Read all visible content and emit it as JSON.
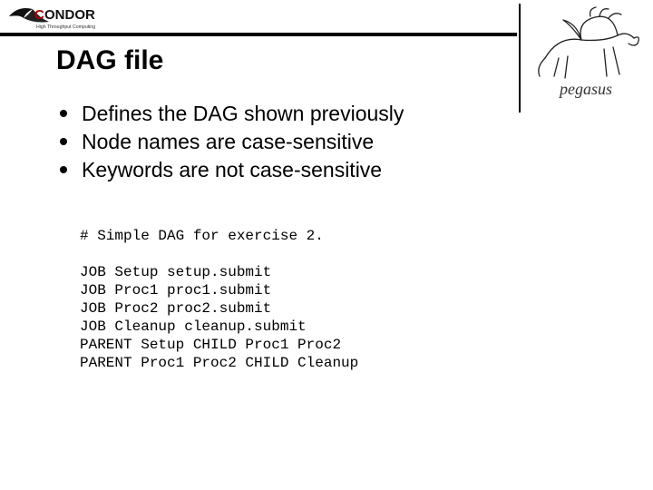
{
  "header": {
    "title": "DAG file",
    "logo_left_name": "CONDOR",
    "logo_left_tagline": "High Throughput Computing",
    "logo_right_label": "pegasus"
  },
  "bullets": [
    "Defines the DAG shown previously",
    "Node names are case-sensitive",
    "Keywords are not case-sensitive"
  ],
  "code": {
    "comment": "# Simple DAG for exercise 2.",
    "lines": [
      "JOB Setup setup.submit",
      "JOB Proc1 proc1.submit",
      "JOB Proc2 proc2.submit",
      "JOB Cleanup cleanup.submit",
      "PARENT Setup CHILD Proc1 Proc2",
      "PARENT Proc1 Proc2 CHILD Cleanup"
    ]
  }
}
